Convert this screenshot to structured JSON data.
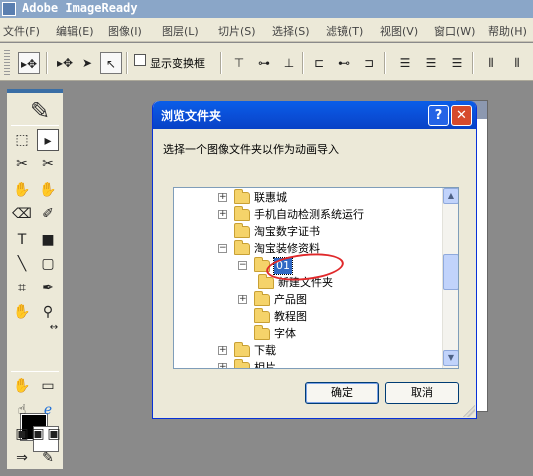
{
  "app": {
    "title": "Adobe ImageReady"
  },
  "menu": [
    "文件(F)",
    "编辑(E)",
    "图像(I)",
    "图层(L)",
    "切片(S)",
    "选择(S)",
    "滤镜(T)",
    "视图(V)",
    "窗口(W)",
    "帮助(H)"
  ],
  "options_bar": {
    "show_transform_label": "显示变换框",
    "show_transform_checked": false
  },
  "dialog": {
    "title": "浏览文件夹",
    "help_glyph": "?",
    "close_glyph": "✕",
    "instruction": "选择一个图像文件夹以作为动画导入",
    "tree": [
      {
        "label": "联惠城",
        "expander": "+"
      },
      {
        "label": "手机自动检测系统运行",
        "expander": "+"
      },
      {
        "label": "淘宝数字证书",
        "expander": ""
      },
      {
        "label": "淘宝装修资料",
        "expander": "−"
      },
      {
        "label": "01",
        "expander": "−",
        "selected": true
      },
      {
        "label": "新建文件夹",
        "expander": ""
      },
      {
        "label": "产品图",
        "expander": "+"
      },
      {
        "label": "教程图",
        "expander": ""
      },
      {
        "label": "字体",
        "expander": ""
      },
      {
        "label": "下载",
        "expander": "+"
      },
      {
        "label": "相片",
        "expander": "+"
      }
    ],
    "ok_label": "确定",
    "cancel_label": "取消"
  },
  "colors": {
    "titlebar": "#0a4fd8",
    "close": "#d64a2c",
    "selection": "#316ac5",
    "annotation": "#e0282a"
  }
}
